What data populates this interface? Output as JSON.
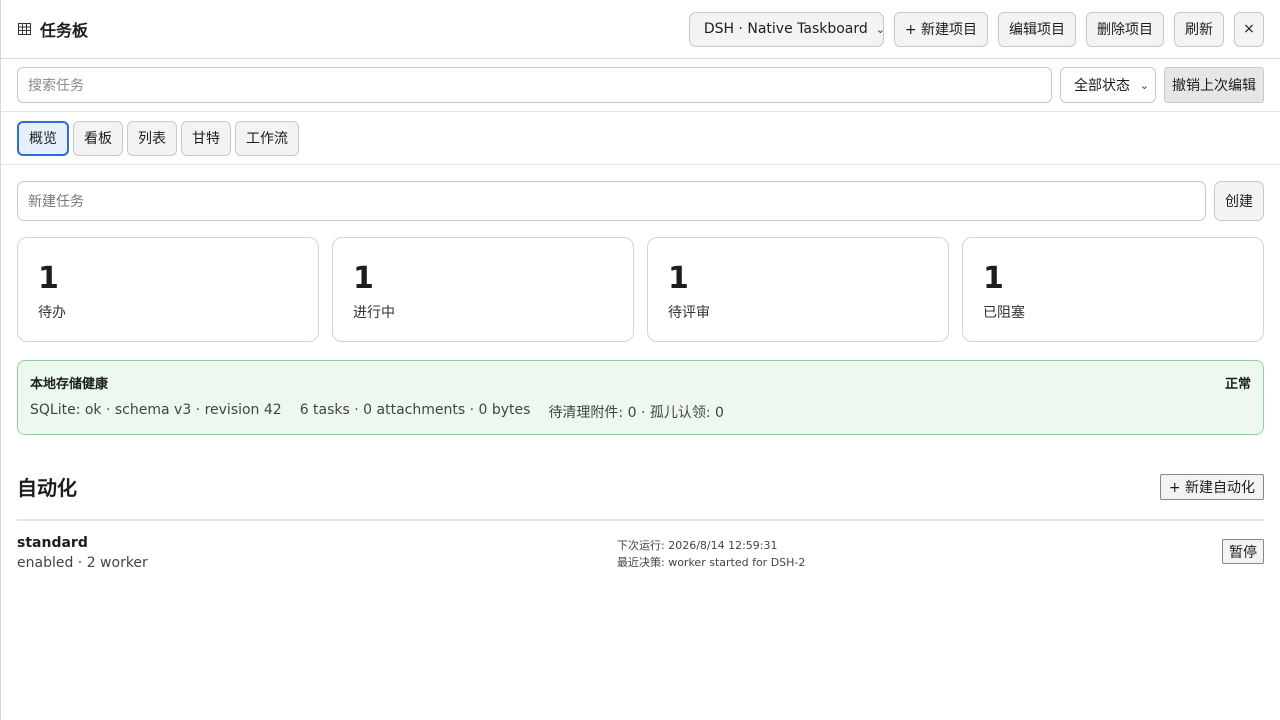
{
  "header": {
    "title": "任务板",
    "project_select": "DSH · Native Taskboard",
    "new_project": "+ 新建项目",
    "edit_project": "编辑项目",
    "delete_project": "删除项目",
    "refresh": "刷新",
    "close": "×"
  },
  "search": {
    "placeholder": "搜索任务",
    "status_filter": "全部状态",
    "undo": "撤销上次编辑"
  },
  "tabs": [
    {
      "label": "概览",
      "active": true
    },
    {
      "label": "看板",
      "active": false
    },
    {
      "label": "列表",
      "active": false
    },
    {
      "label": "甘特",
      "active": false
    },
    {
      "label": "工作流",
      "active": false
    }
  ],
  "new_task": {
    "placeholder": "新建任务",
    "create": "创建"
  },
  "stats": [
    {
      "value": "1",
      "label": "待办"
    },
    {
      "value": "1",
      "label": "进行中"
    },
    {
      "value": "1",
      "label": "待评审"
    },
    {
      "value": "1",
      "label": "已阻塞"
    }
  ],
  "health": {
    "title": "本地存储健康",
    "status": "正常",
    "sqlite": "SQLite: ok · schema v3 · revision 42",
    "counts": "6 tasks · 0 attachments · 0 bytes",
    "pending": "待清理附件: 0 · 孤儿认领: 0",
    "colors": {
      "background": "#edf9ef",
      "border": "#8fd19e"
    }
  },
  "automation": {
    "title": "自动化",
    "new_button": "+ 新建自动化",
    "items": [
      {
        "name": "standard",
        "sub": "enabled · 2 worker",
        "next_run": "下次运行: 2026/8/14 12:59:31",
        "last_decision": "最近决策: worker started for DSH-2",
        "action": "暂停"
      }
    ]
  },
  "colors": {
    "accent": "#2a6fd6"
  }
}
